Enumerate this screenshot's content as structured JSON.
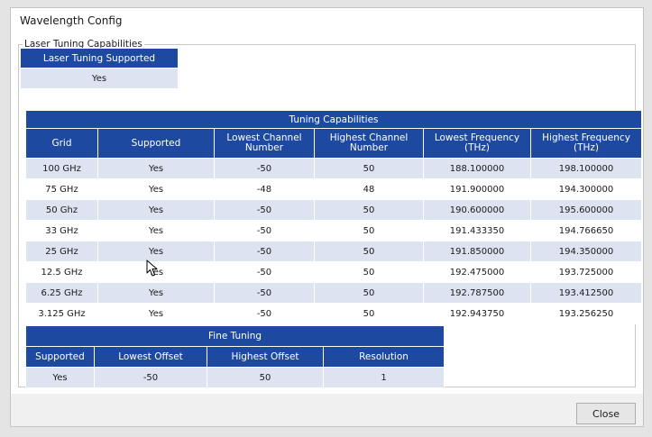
{
  "window": {
    "title": "Wavelength Config"
  },
  "group": {
    "label": "Laser Tuning Capabilities"
  },
  "laser_tuning": {
    "header": "Laser Tuning Supported",
    "value": "Yes"
  },
  "tuning": {
    "caption": "Tuning Capabilities",
    "columns": [
      "Grid",
      "Supported",
      "Lowest Channel Number",
      "Highest Channel Number",
      "Lowest Frequency (THz)",
      "Highest Frequency (THz)"
    ],
    "rows": [
      [
        "100 GHz",
        "Yes",
        "-50",
        "50",
        "188.100000",
        "198.100000"
      ],
      [
        "75 GHz",
        "Yes",
        "-48",
        "48",
        "191.900000",
        "194.300000"
      ],
      [
        "50 Ghz",
        "Yes",
        "-50",
        "50",
        "190.600000",
        "195.600000"
      ],
      [
        "33 GHz",
        "Yes",
        "-50",
        "50",
        "191.433350",
        "194.766650"
      ],
      [
        "25 GHz",
        "Yes",
        "-50",
        "50",
        "191.850000",
        "194.350000"
      ],
      [
        "12.5 GHz",
        "Yes",
        "-50",
        "50",
        "192.475000",
        "193.725000"
      ],
      [
        "6.25 GHz",
        "Yes",
        "-50",
        "50",
        "192.787500",
        "193.412500"
      ],
      [
        "3.125 GHz",
        "Yes",
        "-50",
        "50",
        "192.943750",
        "193.256250"
      ]
    ]
  },
  "fine_tuning": {
    "caption": "Fine Tuning",
    "columns": [
      "Supported",
      "Lowest Offset",
      "Highest Offset",
      "Resolution"
    ],
    "row": [
      "Yes",
      "-50",
      "50",
      "1"
    ]
  },
  "footer": {
    "close_label": "Close"
  },
  "icons": {
    "cursor": "mouse-pointer-icon"
  },
  "colors": {
    "header_bg": "#1d4aa0",
    "row_alt_bg": "#dde3f1"
  }
}
